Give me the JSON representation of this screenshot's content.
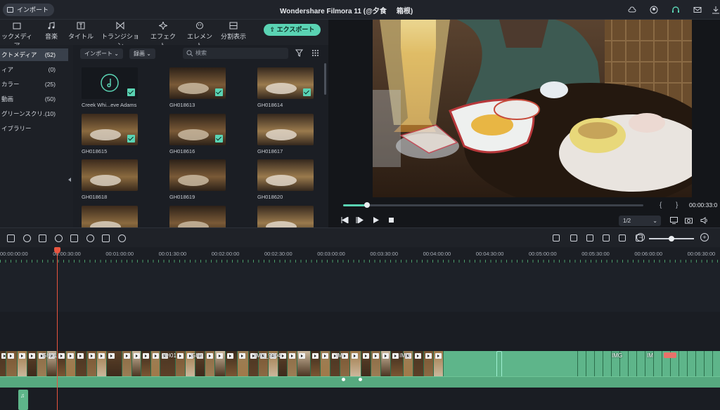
{
  "app": {
    "import_label": "インポート",
    "title": "Wondershare Filmora 11 (@夕食",
    "title_suffix": "箱根)"
  },
  "tabs": [
    {
      "label": "ックメディア",
      "icon": "folder-icon"
    },
    {
      "label": "音楽",
      "icon": "music-note-icon"
    },
    {
      "label": "タイトル",
      "icon": "text-t-icon"
    },
    {
      "label": "トランジション",
      "icon": "transition-icon"
    },
    {
      "label": "エフェクト",
      "icon": "sparkle-icon"
    },
    {
      "label": "エレメント",
      "icon": "element-icon"
    },
    {
      "label": "分割表示",
      "icon": "split-screen-icon"
    }
  ],
  "export_label": "エクスポート",
  "sidebar": {
    "items": [
      {
        "label": "クトメディア",
        "count": "(52)",
        "active": true
      },
      {
        "label": "ィア",
        "count": "(0)"
      },
      {
        "label": "カラー",
        "count": "(25)"
      },
      {
        "label": "動画",
        "count": "(50)"
      },
      {
        "label": "グリーンスクリ…",
        "count": "(10)"
      },
      {
        "label": "イブラリー",
        "count": ""
      }
    ]
  },
  "media_toolbar": {
    "import_dropdown": "インポート",
    "record_dropdown": "録画",
    "search_placeholder": "検索"
  },
  "media_items": [
    {
      "label": "Creek Whi...eve Adams",
      "kind": "audio",
      "checked": true
    },
    {
      "label": "GH018613",
      "kind": "video",
      "checked": true
    },
    {
      "label": "GH018614",
      "kind": "video",
      "checked": true
    },
    {
      "label": "GH018615",
      "kind": "video",
      "checked": true
    },
    {
      "label": "GH018616",
      "kind": "video",
      "checked": true
    },
    {
      "label": "GH018617",
      "kind": "video",
      "checked": false
    },
    {
      "label": "GH018618",
      "kind": "video",
      "checked": false
    },
    {
      "label": "GH018619",
      "kind": "video",
      "checked": false
    },
    {
      "label": "GH018620",
      "kind": "video",
      "checked": false
    },
    {
      "label": "",
      "kind": "video",
      "checked": false
    },
    {
      "label": "",
      "kind": "video",
      "checked": false
    },
    {
      "label": "",
      "kind": "video",
      "checked": false
    }
  ],
  "player": {
    "progress": 0.08,
    "timecode": "00:00:33:0",
    "zoom": "1/2",
    "mark_in": "{",
    "mark_out": "}"
  },
  "ruler": {
    "labels": [
      "00:00:00:00",
      "00:00:30:00",
      "00:01:00:00",
      "00:01:30:00",
      "00:02:00:00",
      "00:02:30:00",
      "00:03:00:00",
      "00:03:30:00",
      "00:04:00:00",
      "00:04:30:00",
      "00:05:00:00",
      "00:05:30:00",
      "00:06:00:00",
      "00:06:30:00"
    ]
  },
  "clips": [
    {
      "name": "GH01"
    },
    {
      "name": "GH01"
    },
    {
      "name": "GH0"
    },
    {
      "name": "IMG_9904"
    },
    {
      "name": "IM"
    },
    {
      "name": "IMG"
    },
    {
      "name": "IMG"
    },
    {
      "name": "IM"
    }
  ],
  "colors": {
    "accent": "#5ad3b3",
    "playhead": "#e8543f",
    "clip": "#5eb58a"
  }
}
